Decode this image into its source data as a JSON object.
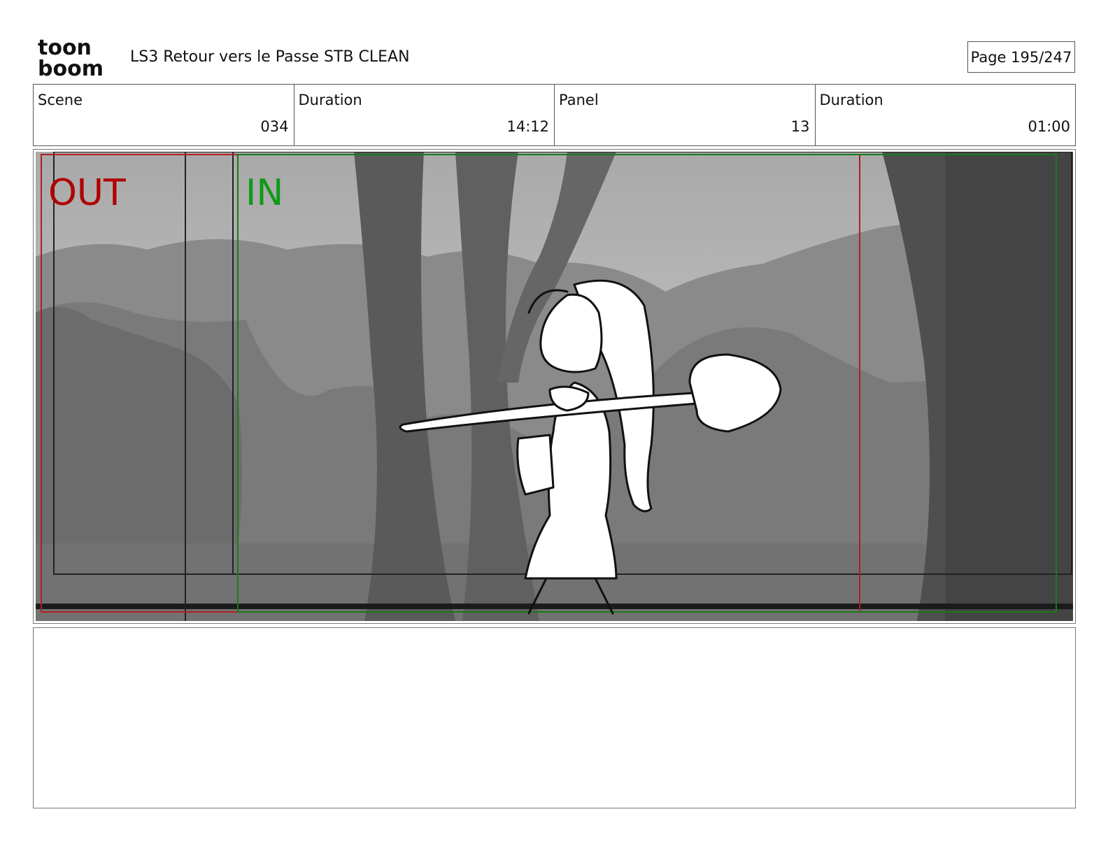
{
  "header": {
    "logo_text_top": "toon",
    "logo_text_bottom": "boom",
    "title": "LS3 Retour vers le Passe STB CLEAN",
    "page": "Page 195/247"
  },
  "info": {
    "scene_label": "Scene",
    "scene_value": "034",
    "scene_duration_label": "Duration",
    "scene_duration_value": "14:12",
    "panel_label": "Panel",
    "panel_value": "13",
    "panel_duration_label": "Duration",
    "panel_duration_value": "01:00"
  },
  "panel": {
    "out_label": "OUT",
    "in_label": "IN",
    "out_color": "#b00000",
    "in_color": "#0f9a1a"
  },
  "notes": {
    "text": ""
  }
}
